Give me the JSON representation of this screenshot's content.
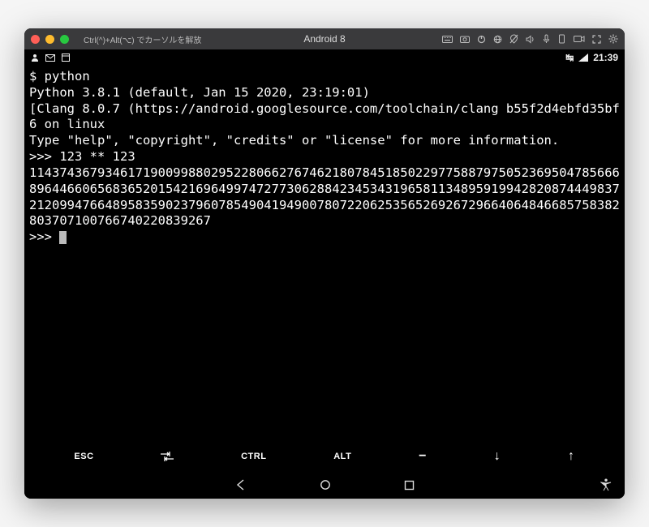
{
  "titlebar": {
    "hint": "Ctrl(^)+Alt(⌥) でカーソルを解放",
    "title": "Android 8"
  },
  "status": {
    "time": "21:39"
  },
  "terminal": {
    "lines": [
      "$ python",
      "Python 3.8.1 (default, Jan 15 2020, 23:19:01)",
      "[Clang 8.0.7 (https://android.googlesource.com/toolchain/clang b55f2d4ebfd35bf6 on linux",
      "Type \"help\", \"copyright\", \"credits\" or \"license\" for more information.",
      ">>> 123 ** 123",
      "11437436793461719009988029522806627674621807845185022977588797505236950478566689644660656836520154216964997472773062884234534319658113489591994282087444983721209947664895835902379607854904194900780722062535652692672966406484668575838280370710076674022083​9267",
      ">>> "
    ]
  },
  "keyrow": {
    "esc": "ESC",
    "ctrl": "CTRL",
    "alt": "ALT",
    "minus": "−",
    "down": "↓",
    "up": "↑"
  }
}
